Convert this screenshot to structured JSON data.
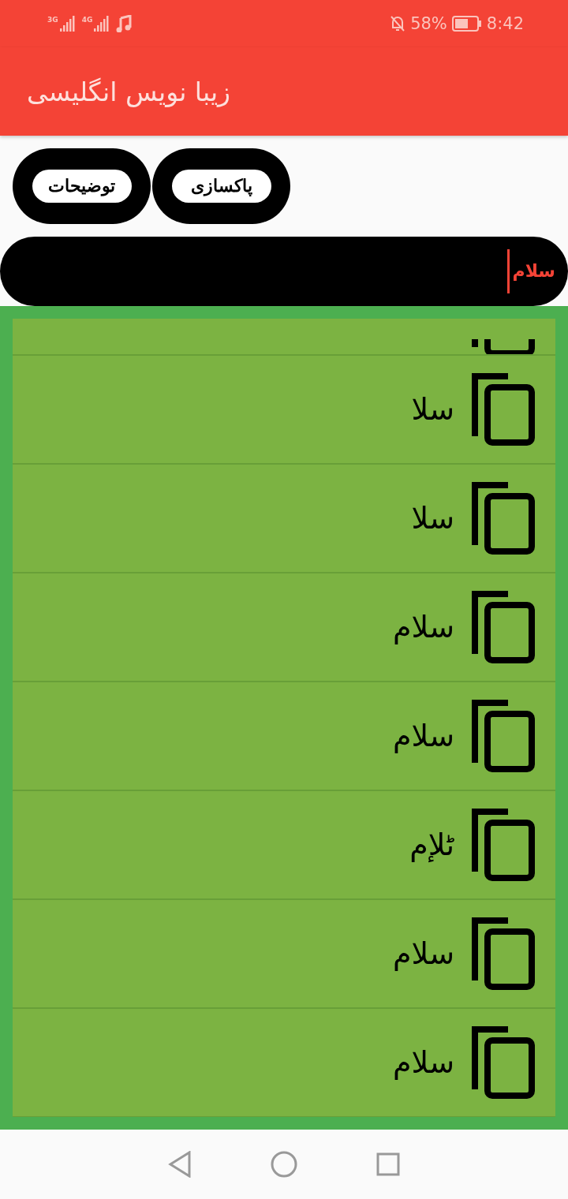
{
  "status_bar": {
    "network_1": "3G",
    "network_2": "4G",
    "battery_percent": "58%",
    "time": "8:42"
  },
  "app_bar": {
    "title": "زیبا نویس انگلیسی"
  },
  "buttons": [
    "پاکسازی",
    "توضیحات"
  ],
  "input": {
    "value": "سلام"
  },
  "results": [
    {
      "text": "سلا"
    },
    {
      "text": "سلا"
    },
    {
      "text": "سلام"
    },
    {
      "text": "سلام"
    },
    {
      "text": "ٹلإم"
    },
    {
      "text": "سلام"
    },
    {
      "text": "سلام"
    }
  ]
}
